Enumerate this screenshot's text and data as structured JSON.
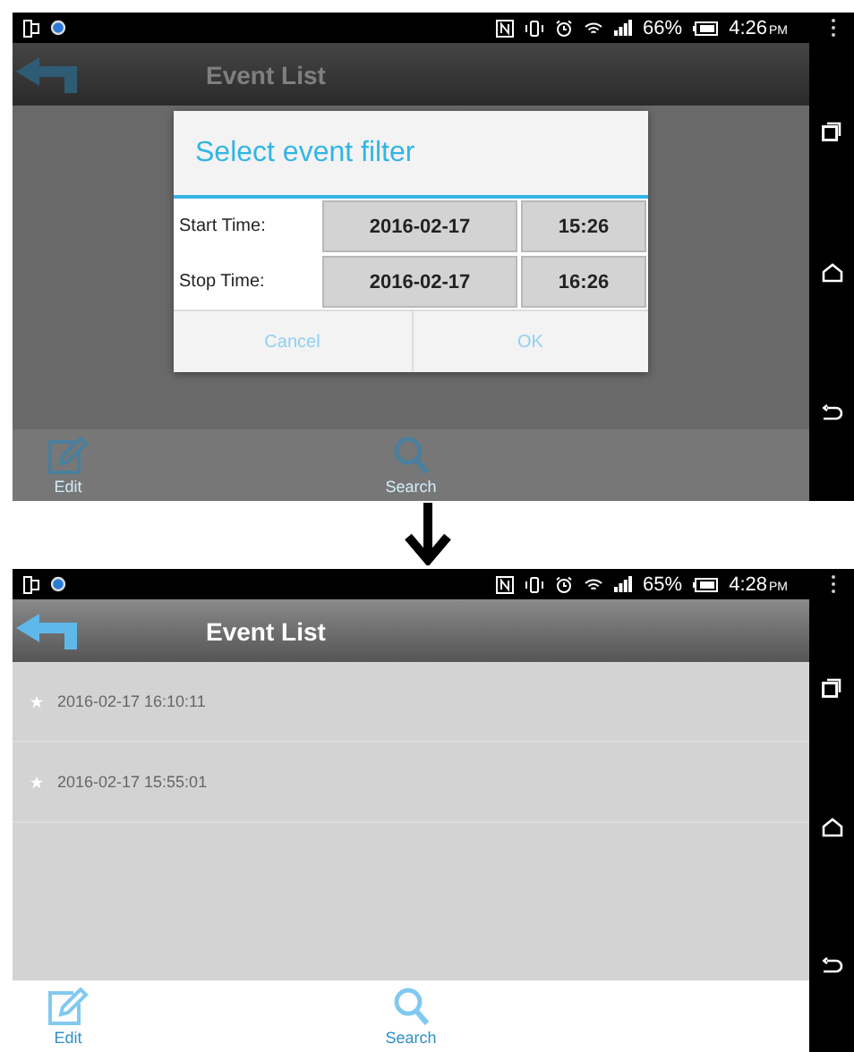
{
  "screens": [
    {
      "status_bar": {
        "battery": "66%",
        "time": "4:26",
        "ampm": "PM"
      },
      "header": {
        "title": "Event List"
      },
      "dimmed": true,
      "dialog": {
        "title": "Select event filter",
        "rows": [
          {
            "label": "Start Time:",
            "date": "2016-02-17",
            "time": "15:26"
          },
          {
            "label": "Stop Time:",
            "date": "2016-02-17",
            "time": "16:26"
          }
        ],
        "buttons": [
          "Cancel",
          "OK"
        ]
      },
      "toolbar": [
        {
          "kind": "edit",
          "label": "Edit"
        },
        {
          "kind": "search",
          "label": "Search"
        }
      ]
    },
    {
      "status_bar": {
        "battery": "65%",
        "time": "4:28",
        "ampm": "PM"
      },
      "header": {
        "title": "Event List"
      },
      "dimmed": false,
      "events": [
        {
          "text": "2016-02-17 16:10:11"
        },
        {
          "text": "2016-02-17 15:55:01"
        }
      ],
      "toolbar": [
        {
          "kind": "edit",
          "label": "Edit"
        },
        {
          "kind": "search",
          "label": "Search"
        }
      ]
    }
  ]
}
